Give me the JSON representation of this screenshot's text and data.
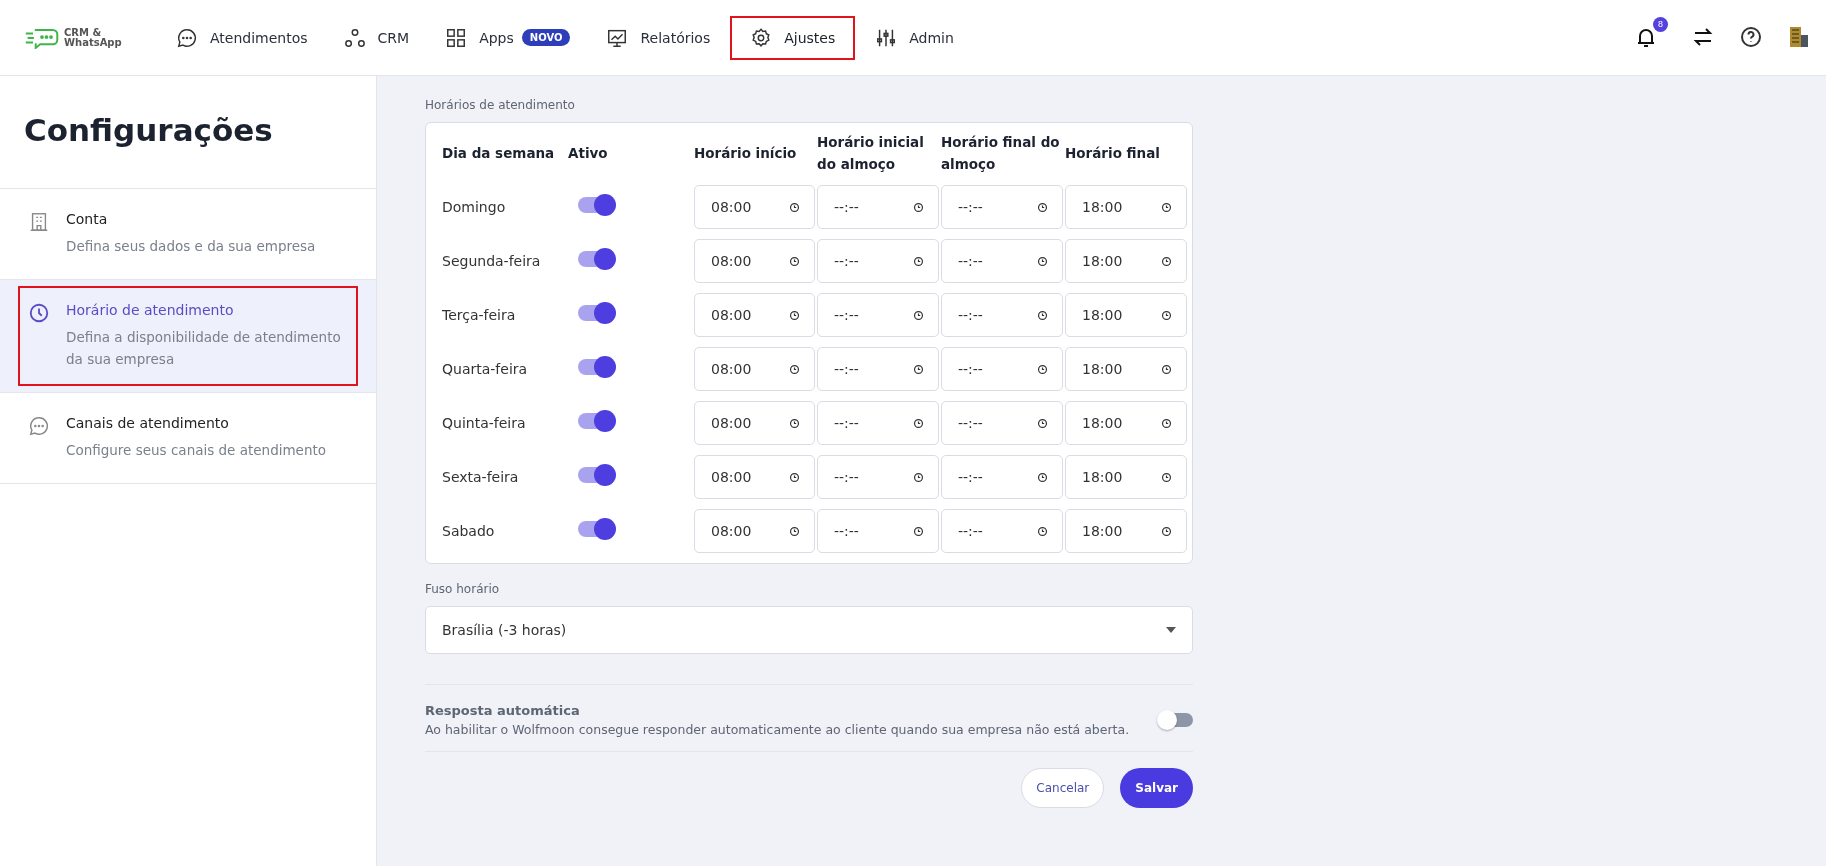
{
  "header": {
    "logo": "CRM & WhatsApp",
    "nav": [
      {
        "label": "Atendimentos",
        "selected": false,
        "highlighted": false
      },
      {
        "label": "CRM",
        "selected": false,
        "highlighted": false
      },
      {
        "label": "Apps",
        "badge": "NOVO",
        "selected": false,
        "highlighted": false
      },
      {
        "label": "Relatórios",
        "selected": false,
        "highlighted": false
      },
      {
        "label": "Ajustes",
        "selected": true,
        "highlighted": true
      },
      {
        "label": "Admin",
        "selected": false,
        "highlighted": false
      }
    ],
    "notification_count": "8"
  },
  "sidebar": {
    "title": "Configurações",
    "items": [
      {
        "title": "Conta",
        "description": "Defina seus dados e da sua empresa",
        "selected": false,
        "highlighted": false
      },
      {
        "title": "Horário de atendimento",
        "description": "Defina a disponibilidade de atendimento da sua empresa",
        "selected": true,
        "highlighted": true
      },
      {
        "title": "Canais de atendimento",
        "description": "Configure seus canais de atendimento",
        "selected": false,
        "highlighted": false
      }
    ]
  },
  "schedule": {
    "label": "Horários de atendimento",
    "columns": [
      "Dia da semana",
      "Ativo",
      "Horário início",
      "Horário inicial do almoço",
      "Horário final do almoço",
      "Horário final"
    ],
    "rows": [
      {
        "day": "Domingo",
        "active": true,
        "times": [
          "08:00",
          "--:--",
          "--:--",
          "18:00"
        ]
      },
      {
        "day": "Segunda-feira",
        "active": true,
        "times": [
          "08:00",
          "--:--",
          "--:--",
          "18:00"
        ]
      },
      {
        "day": "Terça-feira",
        "active": true,
        "times": [
          "08:00",
          "--:--",
          "--:--",
          "18:00"
        ]
      },
      {
        "day": "Quarta-feira",
        "active": true,
        "times": [
          "08:00",
          "--:--",
          "--:--",
          "18:00"
        ]
      },
      {
        "day": "Quinta-feira",
        "active": true,
        "times": [
          "08:00",
          "--:--",
          "--:--",
          "18:00"
        ]
      },
      {
        "day": "Sexta-feira",
        "active": true,
        "times": [
          "08:00",
          "--:--",
          "--:--",
          "18:00"
        ]
      },
      {
        "day": "Sabado",
        "active": true,
        "times": [
          "08:00",
          "--:--",
          "--:--",
          "18:00"
        ]
      }
    ]
  },
  "timezone": {
    "label": "Fuso horário",
    "value": "Brasília (-3 horas)"
  },
  "auto_reply": {
    "title": "Resposta automática",
    "description": "Ao habilitar o Wolfmoon consegue responder automaticamente ao cliente quando sua empresa não está aberta.",
    "on": false
  },
  "buttons": [
    {
      "label": "Cancelar",
      "kind": "secondary"
    },
    {
      "label": "Salvar",
      "kind": "primary"
    }
  ]
}
